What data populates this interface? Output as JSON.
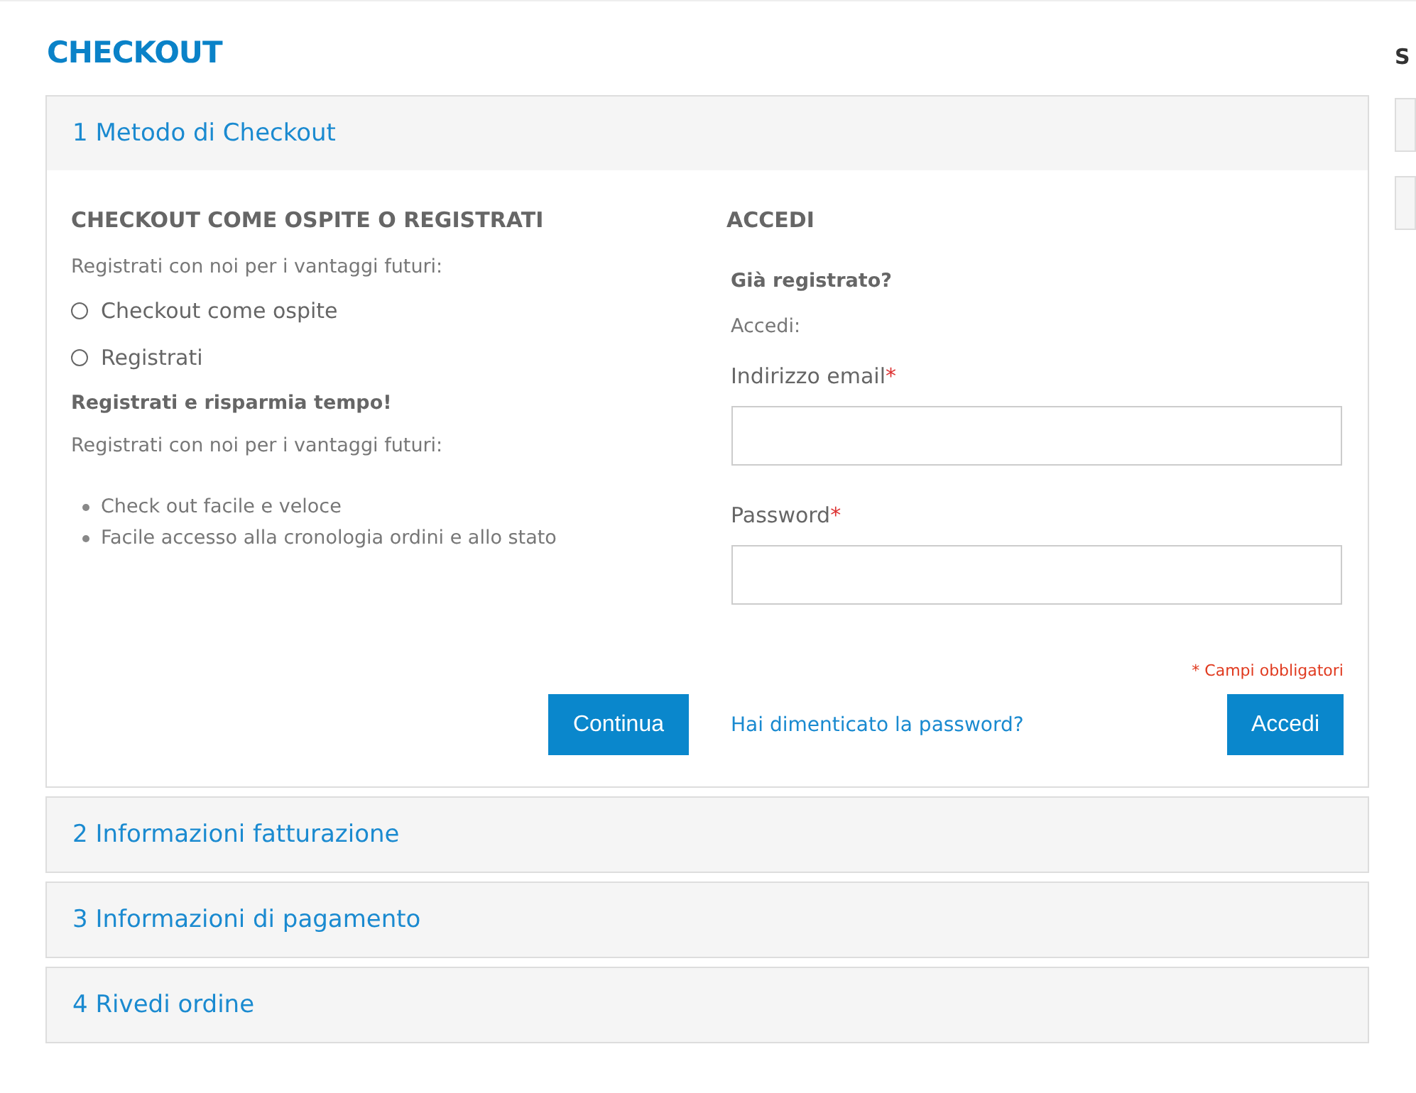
{
  "page_title": "CHECKOUT",
  "steps": [
    {
      "title": "1 Metodo di Checkout",
      "expanded": true,
      "body": {
        "left": {
          "heading": "CHECKOUT COME OSPITE O REGISTRATI",
          "intro": "Registrati con noi per i vantaggi futuri:",
          "options": [
            {
              "label": "Checkout come ospite",
              "selected": false
            },
            {
              "label": "Registrati",
              "selected": false
            }
          ],
          "promo_title": "Registrati e risparmia tempo!",
          "promo_text": "Registrati con noi per i vantaggi futuri:",
          "benefits": [
            "Check out facile e veloce",
            "Facile accesso alla cronologia ordini e allo stato"
          ],
          "button": "Continua"
        },
        "right": {
          "heading": "ACCEDI",
          "subtitle": "Già registrato?",
          "prompt": "Accedi:",
          "fields": [
            {
              "label": "Indirizzo email",
              "required_mark": "*"
            },
            {
              "label": "Password",
              "required_mark": "*"
            }
          ],
          "required_note": "* Campi obbligatori",
          "link": "Hai dimenticato la password?",
          "button": "Accedi"
        }
      }
    },
    {
      "title": "2 Informazioni fatturazione",
      "expanded": false
    },
    {
      "title": "3 Informazioni di pagamento",
      "expanded": false
    },
    {
      "title": "4 Rivedi ordine",
      "expanded": false
    }
  ],
  "sidebar": {
    "title": "S"
  }
}
